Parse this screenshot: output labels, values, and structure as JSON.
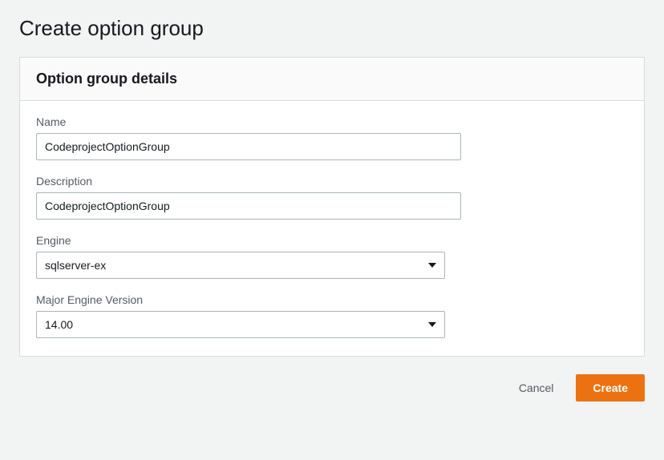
{
  "page_title": "Create option group",
  "panel": {
    "title": "Option group details",
    "fields": {
      "name": {
        "label": "Name",
        "value": "CodeprojectOptionGroup"
      },
      "description": {
        "label": "Description",
        "value": "CodeprojectOptionGroup"
      },
      "engine": {
        "label": "Engine",
        "value": "sqlserver-ex"
      },
      "major_engine_version": {
        "label": "Major Engine Version",
        "value": "14.00"
      }
    }
  },
  "buttons": {
    "cancel": "Cancel",
    "create": "Create"
  }
}
